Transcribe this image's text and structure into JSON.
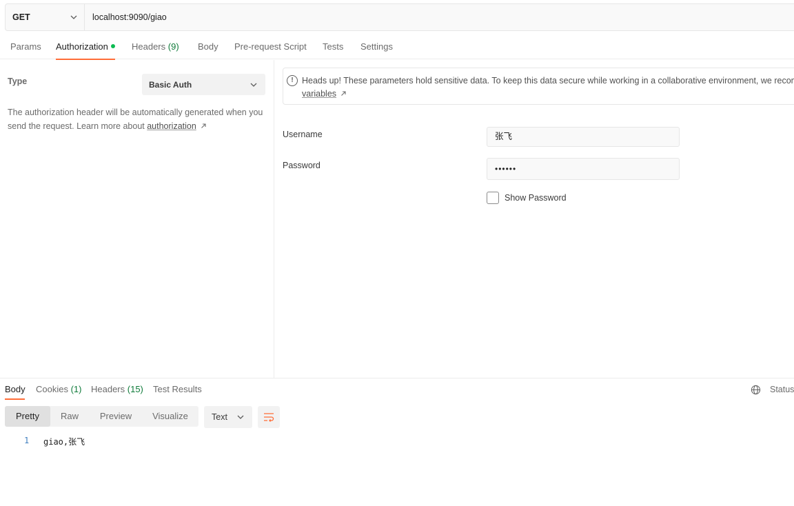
{
  "request": {
    "method": "GET",
    "url": "localhost:9090/giao"
  },
  "request_tabs": [
    {
      "label": "Params"
    },
    {
      "label": "Authorization"
    },
    {
      "label": "Headers",
      "count": "(9)"
    },
    {
      "label": "Body"
    },
    {
      "label": "Pre-request Script"
    },
    {
      "label": "Tests"
    },
    {
      "label": "Settings"
    }
  ],
  "auth": {
    "type_label": "Type",
    "type_value": "Basic Auth",
    "description": "The authorization header will be automatically generated when you send the request. Learn more about ",
    "description_link": "authorization",
    "notice_text": "Heads up! These parameters hold sensitive data. To keep this data secure while working in a collaborative environment, we recommend using",
    "notice_link": "variables",
    "username_label": "Username",
    "username_value": "张飞",
    "password_label": "Password",
    "password_value": "••••••",
    "show_password_label": "Show Password"
  },
  "response_tabs": [
    {
      "label": "Body"
    },
    {
      "label": "Cookies",
      "count": "(1)"
    },
    {
      "label": "Headers",
      "count": "(15)"
    },
    {
      "label": "Test Results"
    }
  ],
  "response": {
    "status_label": "Status:",
    "views": [
      "Pretty",
      "Raw",
      "Preview",
      "Visualize"
    ],
    "format": "Text",
    "lines": [
      {
        "number": "1",
        "text": "giao,张飞"
      }
    ]
  },
  "colors": {
    "accent": "#ff6c37",
    "count_green": "#0f7b3a",
    "auth_dot": "#0cbb52"
  },
  "icons": [
    "chevron-down-icon",
    "info-icon",
    "external-arrow-icon",
    "globe-icon",
    "wrap-lines-icon"
  ]
}
